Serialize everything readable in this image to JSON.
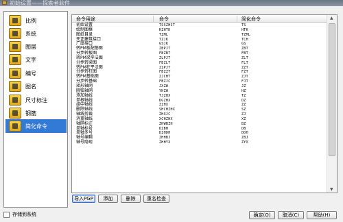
{
  "window": {
    "title": "初始设置——探索者软件"
  },
  "sidebar": {
    "items": [
      {
        "label": "比例",
        "icon": "ruler-icon"
      },
      {
        "label": "系统",
        "icon": "system-icon"
      },
      {
        "label": "图层",
        "icon": "layers-icon"
      },
      {
        "label": "文字",
        "icon": "text-icon"
      },
      {
        "label": "编号",
        "icon": "numbering-icon"
      },
      {
        "label": "图名",
        "icon": "drawing-name-icon"
      },
      {
        "label": "尺寸标注",
        "icon": "dimension-icon"
      },
      {
        "label": "钢筋",
        "icon": "rebar-icon"
      },
      {
        "label": "简化命令",
        "icon": "shortcut-icon"
      }
    ],
    "selected_index": 8,
    "selected_color": "#3379d6"
  },
  "table": {
    "headers": [
      "命令用途",
      "命令",
      "简化命令"
    ],
    "rows": [
      [
        "初始设置",
        "TSSZHST",
        "TS"
      ],
      [
        "绘制图框",
        "HZHTK",
        "HTK"
      ],
      [
        "图纸目录",
        "TZML",
        "TZML"
      ],
      [
        "天正建筑接口",
        "TZJK",
        "TCH"
      ],
      [
        "广厦接口",
        "GSJK",
        "GS"
      ],
      [
        "转PM板配筋图",
        "ZBPJT",
        "ZBT"
      ],
      [
        "分步转板图",
        "FBZBT",
        "FBT"
      ],
      [
        "转PM梁平法图",
        "ZLPJT",
        "ZLT"
      ],
      [
        "分步转梁图",
        "FBZLT",
        "FLT"
      ],
      [
        "转PM柱平法图",
        "ZZPJT",
        "ZZT"
      ],
      [
        "分步转柱图",
        "FBZZT",
        "FZT"
      ],
      [
        "转PM基础图",
        "ZJCHT",
        "ZJT"
      ],
      [
        "分步转基础",
        "FBZJC",
        "FJT"
      ],
      [
        "矩形轴网",
        "JXZW",
        "JZ"
      ],
      [
        "圆弧轴网",
        "YHZW",
        "HZ"
      ],
      [
        "添加轴线",
        "TJZHX",
        "TZ"
      ],
      [
        "单根轴线",
        "DGZHX",
        "DZ"
      ],
      [
        "组中轴线",
        "ZZHX",
        "ZZ"
      ],
      [
        "删除轴线",
        "SHCHZHX",
        "SZ"
      ],
      [
        "轴线剪裁",
        "ZHXJC",
        "ZJ"
      ],
      [
        "消重轴线",
        "XCHZHX",
        "XZ"
      ],
      [
        "轴网标注",
        "ZHWBZH",
        "BZ"
      ],
      [
        "单轴标号",
        "DZBH",
        "DB"
      ],
      [
        "单轴多号",
        "DZHDH",
        "DDH"
      ],
      [
        "轴号编辑",
        "ZHHBJ",
        "ZBJ"
      ],
      [
        "轴号隐现",
        "ZHHYX",
        "ZYX"
      ]
    ]
  },
  "buttons": {
    "import_pgp": "导入PGP",
    "add": "添加",
    "delete": "删除",
    "rename_check": "重名检查",
    "ok": "确定(O)",
    "cancel": "取消(C)",
    "help": "帮助(H)"
  },
  "checkbox": {
    "label": "存储到系统",
    "checked": false
  }
}
